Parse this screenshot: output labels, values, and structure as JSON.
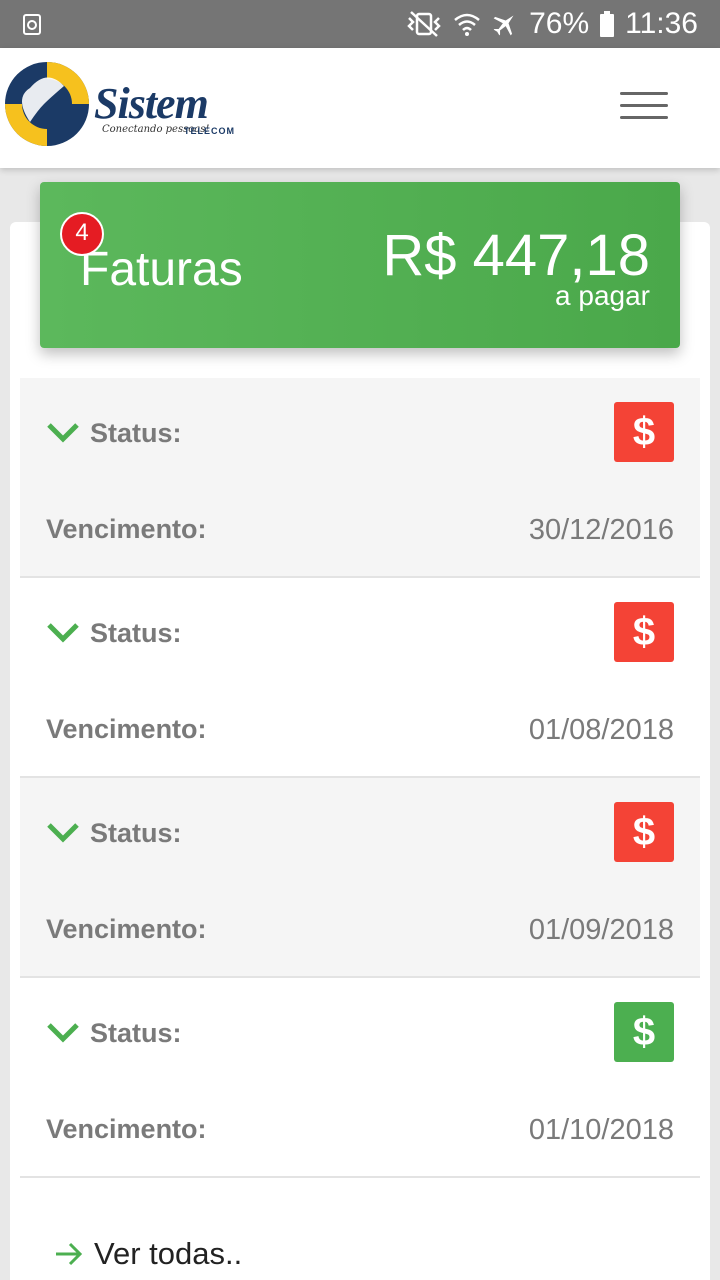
{
  "status_bar": {
    "battery": "76%",
    "time": "11:36",
    "icons": [
      "recycle-icon",
      "vibrate-icon",
      "wifi-icon",
      "airplane-icon",
      "battery-icon"
    ]
  },
  "header": {
    "brand": "Sistem",
    "brand_sub": "TELECOM",
    "tagline": "Conectando pessoas!",
    "menu_icon": "hamburger-menu-icon"
  },
  "summary": {
    "badge_count": "4",
    "title": "Faturas",
    "amount": "R$ 447,18",
    "amount_caption": "a pagar",
    "color": "#5cb85c"
  },
  "invoices": [
    {
      "status_label": "Status:",
      "due_label": "Vencimento:",
      "due_date": "30/12/2016",
      "pay_icon": "$",
      "status_color": "#f44336"
    },
    {
      "status_label": "Status:",
      "due_label": "Vencimento:",
      "due_date": "01/08/2018",
      "pay_icon": "$",
      "status_color": "#f44336"
    },
    {
      "status_label": "Status:",
      "due_label": "Vencimento:",
      "due_date": "01/09/2018",
      "pay_icon": "$",
      "status_color": "#f44336"
    },
    {
      "status_label": "Status:",
      "due_label": "Vencimento:",
      "due_date": "01/10/2018",
      "pay_icon": "$",
      "status_color": "#4caf50"
    }
  ],
  "footer": {
    "see_all": "Ver todas.."
  },
  "colors": {
    "accent_green": "#4caf50",
    "alert_red": "#f44336",
    "brand_navy": "#1b3a66",
    "brand_yellow": "#f6c11e"
  }
}
